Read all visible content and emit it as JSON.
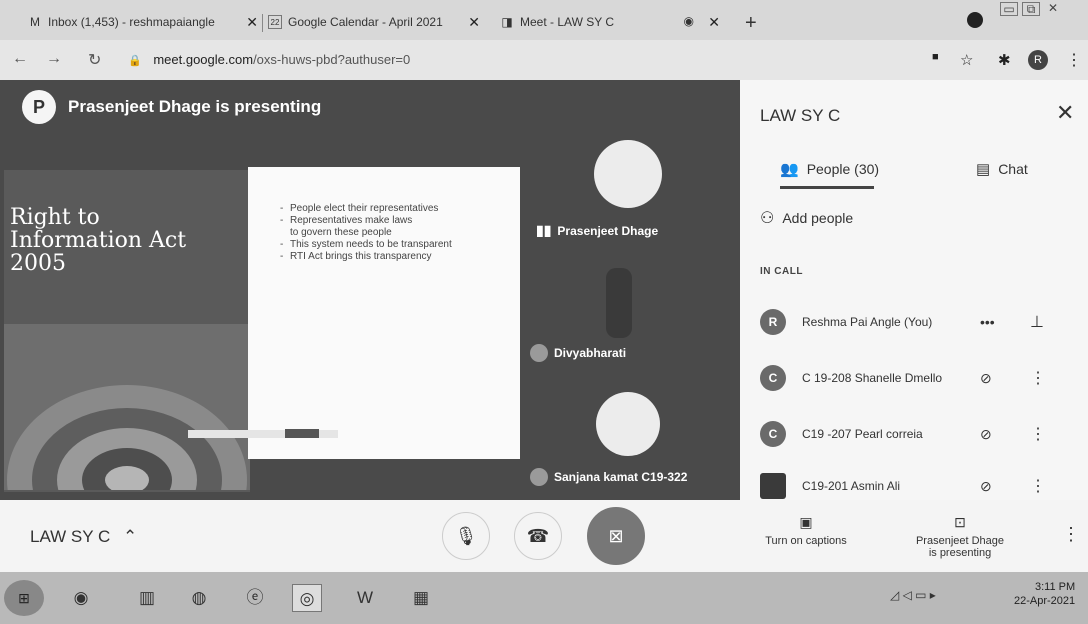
{
  "tabs": [
    {
      "icon": "gmail-icon",
      "glyph": "M",
      "label": "Inbox (1,453) - reshmapaiangle"
    },
    {
      "icon": "calendar-icon",
      "glyph": "22",
      "label": "Google Calendar - April 2021"
    },
    {
      "icon": "meet-icon",
      "glyph": "◨",
      "label": "Meet - LAW SY C"
    }
  ],
  "address_bar": {
    "host": "meet.google.com",
    "path": "/oxs-huws-pbd?authuser=0",
    "profile_initial": "R"
  },
  "presentation": {
    "presenting_banner": "Prasenjeet Dhage is presenting",
    "presenter_initial": "P",
    "slide_title_lines": [
      "Right to",
      "Information Act",
      "2005"
    ],
    "bullets": [
      "People elect their representatives",
      "Representatives make laws to govern these people",
      "This system needs to be transparent",
      "RTI Act brings this transparency"
    ]
  },
  "tiles": [
    {
      "name": "Prasenjeet Dhage"
    },
    {
      "name": "Divyabharati"
    },
    {
      "name": "Sanjana kamat C19-322"
    }
  ],
  "panel": {
    "title": "LAW SY C",
    "tab_people": "People (30)",
    "tab_chat": "Chat",
    "add_people": "Add people",
    "in_call_label": "IN CALL",
    "participants": [
      {
        "initial": "R",
        "name": "Reshma Pai Angle (You)"
      },
      {
        "initial": "C",
        "name": "C 19-208 Shanelle Dmello"
      },
      {
        "initial": "C",
        "name": "C19 -207 Pearl correia"
      },
      {
        "initial": "",
        "name": "C19-201 Asmin Ali"
      }
    ]
  },
  "bottom_bar": {
    "meeting_title": "LAW SY C",
    "captions_label": "Turn on captions",
    "presenting_label_1": "Prasenjeet Dhage",
    "presenting_label_2": "is presenting"
  },
  "clock": {
    "time": "3:11 PM",
    "date": "22-Apr-2021"
  }
}
